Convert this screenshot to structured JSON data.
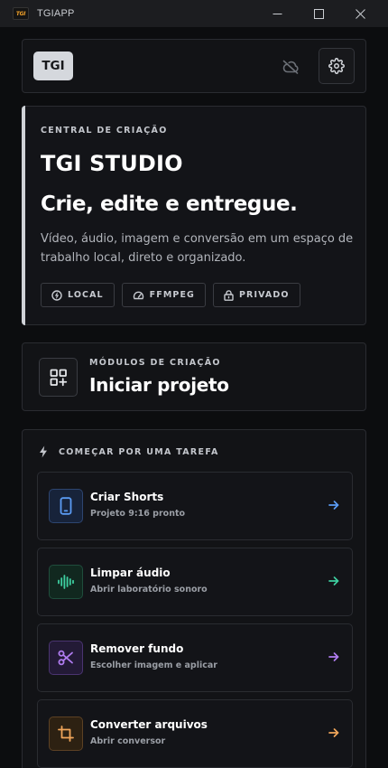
{
  "window": {
    "logo_text": "TGI",
    "title": "TGIAPP"
  },
  "topbar": {
    "badge": "TGI",
    "cloud_icon": "cloud-off-icon",
    "settings_icon": "gear-icon"
  },
  "hero": {
    "eyebrow": "CENTRAL DE CRIAÇÃO",
    "title": "TGI STUDIO",
    "headline": "Crie, edite e entregue.",
    "description": "Vídeo, áudio, imagem e conversão em um espaço de trabalho local, direto e organizado.",
    "tags": [
      {
        "label": "LOCAL",
        "icon": "power-icon"
      },
      {
        "label": "FFMPEG",
        "icon": "gauge-icon"
      },
      {
        "label": "PRIVADO",
        "icon": "lock-icon"
      }
    ]
  },
  "modules": {
    "eyebrow": "MÓDULOS DE CRIAÇÃO",
    "title": "Iniciar projeto",
    "icon": "grid-plus-icon"
  },
  "tasks": {
    "heading": "COMEÇAR POR UMA TAREFA",
    "heading_icon": "bolt-icon",
    "items": [
      {
        "title": "Criar Shorts",
        "subtitle": "Projeto 9:16 pronto",
        "icon": "phone-icon",
        "accent": "#5b9cf5"
      },
      {
        "title": "Limpar áudio",
        "subtitle": "Abrir laboratório sonoro",
        "icon": "waveform-icon",
        "accent": "#3ecfa0"
      },
      {
        "title": "Remover fundo",
        "subtitle": "Escolher imagem e aplicar",
        "icon": "scissors-icon",
        "accent": "#b07cf0"
      },
      {
        "title": "Converter arquivos",
        "subtitle": "Abrir conversor",
        "icon": "crop-icon",
        "accent": "#f0a55a"
      }
    ]
  }
}
